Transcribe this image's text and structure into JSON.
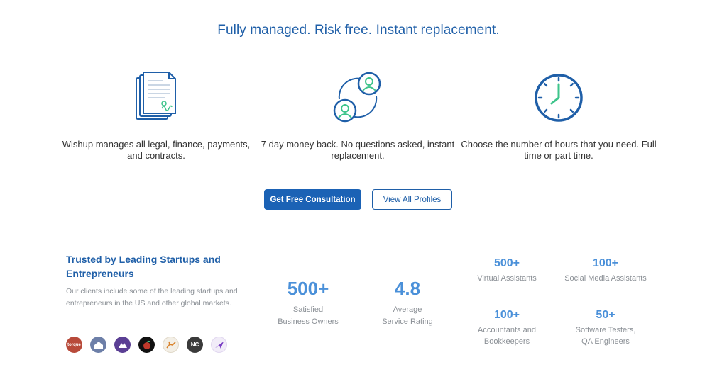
{
  "headline": "Fully managed. Risk free. Instant replacement.",
  "features": [
    {
      "icon": "contract-document-icon",
      "text": "Wishup manages all legal, finance, payments, and contracts."
    },
    {
      "icon": "user-swap-icon",
      "text": "7 day money back. No questions asked, instant replacement."
    },
    {
      "icon": "clock-icon",
      "text": "Choose the number of hours that you need. Full time or part time."
    }
  ],
  "buttons": {
    "primary": "Get Free Consultation",
    "secondary": "View All Profiles"
  },
  "trusted": {
    "title": "Trusted by Leading Startups and Entrepreneurs",
    "description": "Our clients include some of the leading startups and entrepreneurs in the US and other global markets.",
    "logos": [
      {
        "name": "torque-logo",
        "label": "torque",
        "color": "#b84a3a"
      },
      {
        "name": "house-logo",
        "label": "",
        "color": "#6d7fa8"
      },
      {
        "name": "mountain-logo",
        "label": "",
        "color": "#5b3f94"
      },
      {
        "name": "fruit-logo",
        "label": "",
        "color": "#111111"
      },
      {
        "name": "deer-logo",
        "label": "",
        "color": "#f3efe6"
      },
      {
        "name": "nc-logo",
        "label": "NC",
        "color": "#3a3a3a"
      },
      {
        "name": "bird-logo",
        "label": "",
        "color": "#f1ecf8"
      }
    ]
  },
  "stats_main": [
    {
      "value": "500+",
      "label_line1": "Satisfied",
      "label_line2": "Business Owners"
    },
    {
      "value": "4.8",
      "label_line1": "Average",
      "label_line2": "Service Rating"
    }
  ],
  "stats_side": [
    {
      "value": "500+",
      "label_line1": "Virtual Assistants",
      "label_line2": ""
    },
    {
      "value": "100+",
      "label_line1": "Social Media Assistants",
      "label_line2": ""
    },
    {
      "value": "100+",
      "label_line1": "Accountants and",
      "label_line2": "Bookkeepers"
    },
    {
      "value": "50+",
      "label_line1": "Software Testers,",
      "label_line2": "QA Engineers"
    }
  ],
  "colors": {
    "brand_blue": "#1f5fa8",
    "accent_green": "#3ec48b",
    "stat_blue": "#4a90d9"
  }
}
